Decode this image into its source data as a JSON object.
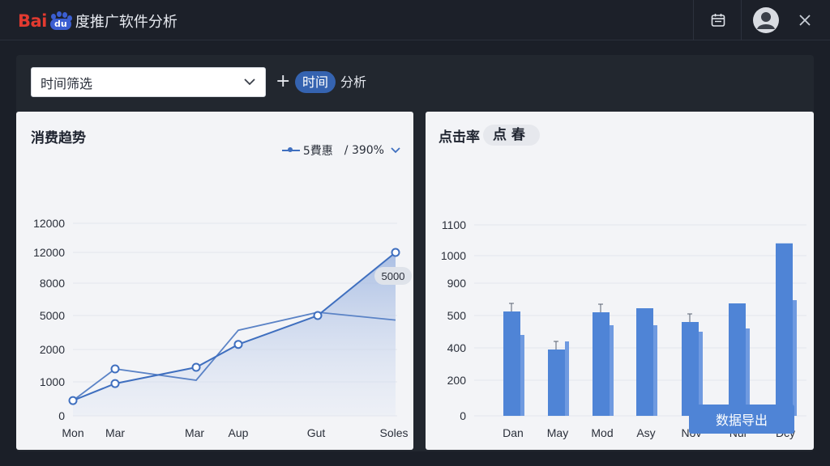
{
  "app": {
    "logo_text": "Bai",
    "logo_paw_text": "du",
    "title": "度推广软件分析"
  },
  "titlebar": {
    "icons": [
      "calendar-icon",
      "user-avatar-icon",
      "close-icon"
    ]
  },
  "toolbar": {
    "select_value": "时间筛选",
    "add_label": "+",
    "pill_label": "时间",
    "pill_suffix": "分析"
  },
  "left_card": {
    "title": "消费趋势",
    "legend_label": "5費惠",
    "legend_pct": "/ 390%",
    "tooltip_value": "5000"
  },
  "right_card": {
    "title": "点击率",
    "tag": "点 春",
    "export_label": "数据导出"
  },
  "colors": {
    "accent": "#3f6fbf",
    "bar": "#4f84d6",
    "panel": "#22272f",
    "card": "#f3f4f7"
  },
  "chart_data": [
    {
      "type": "line",
      "title": "消费趋势",
      "y_tick_labels": [
        "0",
        "1000",
        "2000",
        "5000",
        "8000",
        "12000",
        "12000"
      ],
      "x_tick_labels": [
        "Mon",
        "Mar",
        "Mar",
        "Aup",
        "Gut",
        "Soles"
      ],
      "series": [
        {
          "name": "5費惠",
          "points": [
            {
              "x": "Mon",
              "y": 450
            },
            {
              "x": "Mar",
              "y": 950
            },
            {
              "x": "Mar",
              "y": 1450
            },
            {
              "x": "Aup",
              "y": 2450
            },
            {
              "x": "Gut",
              "y": 5000
            },
            {
              "x": "Soles",
              "y": 12000
            }
          ]
        }
      ],
      "secondary_line": [
        450,
        1400,
        1050,
        3700,
        5300,
        4600
      ],
      "grid": true
    },
    {
      "type": "bar",
      "title": "点击率",
      "y_tick_labels": [
        "0",
        "200",
        "400",
        "500",
        "900",
        "1000",
        "1100"
      ],
      "categories": [
        "Dan",
        "May",
        "Mod",
        "Asy",
        "Nov",
        "Nur",
        "Dcy"
      ],
      "series": [
        {
          "name": "",
          "values": [
            550,
            390,
            540,
            590,
            480,
            650,
            1040
          ]
        },
        {
          "name": "",
          "values": [
            440,
            420,
            470,
            470,
            450,
            460,
            690
          ]
        }
      ],
      "error_bars": [
        true,
        true,
        true,
        false,
        true,
        false,
        false
      ],
      "grid": true
    }
  ]
}
